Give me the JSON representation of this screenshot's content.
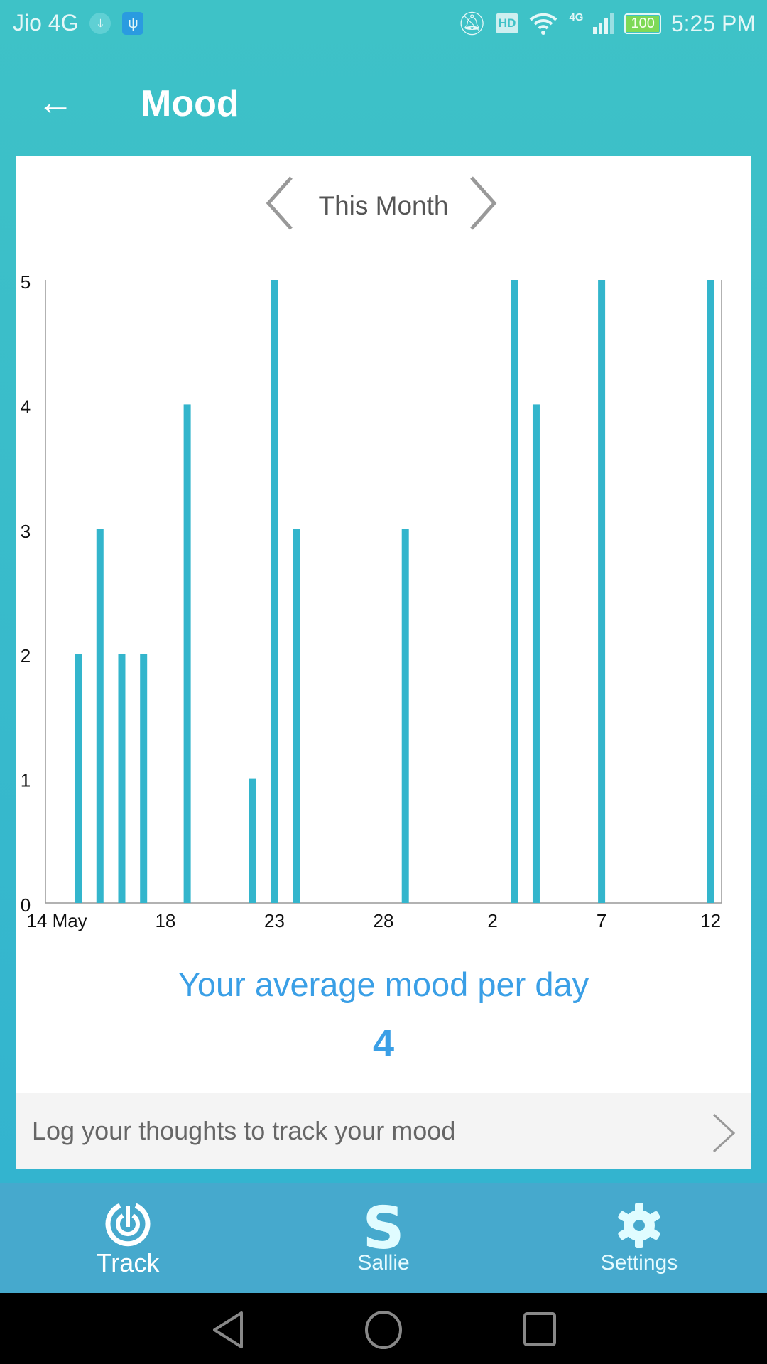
{
  "status": {
    "carrier": "Jio 4G",
    "network": "4G",
    "battery": "100",
    "time": "5:25 PM",
    "hd": "HD"
  },
  "header": {
    "title": "Mood",
    "back_icon": "arrow-left-icon"
  },
  "period": {
    "label": "This Month"
  },
  "chart_data": {
    "type": "bar",
    "ylim": [
      0,
      5
    ],
    "yticks": [
      "0",
      "1",
      "2",
      "3",
      "4",
      "5"
    ],
    "xticks": [
      {
        "day": 0,
        "label": "14 May"
      },
      {
        "day": 4,
        "label": "18"
      },
      {
        "day": 9,
        "label": "23"
      },
      {
        "day": 14,
        "label": "28"
      },
      {
        "day": 19,
        "label": "2"
      },
      {
        "day": 24,
        "label": "7"
      },
      {
        "day": 29,
        "label": "12"
      }
    ],
    "categories": [
      "14 May",
      "15 May",
      "16 May",
      "17 May",
      "19 May",
      "22 May",
      "23 May",
      "24 May",
      "29 May",
      "3 Jun",
      "4 Jun",
      "7 Jun",
      "12 Jun"
    ],
    "days": [
      0,
      1,
      2,
      3,
      5,
      8,
      9,
      10,
      15,
      20,
      21,
      24,
      29
    ],
    "values": [
      2,
      3,
      2,
      2,
      4,
      1,
      5,
      3,
      3,
      5,
      4,
      5,
      5
    ],
    "bar_color": "#33b5cc"
  },
  "summary": {
    "label": "Your average mood per day",
    "value": "4"
  },
  "log": {
    "label": "Log your thoughts to track your mood"
  },
  "nav": {
    "items": [
      {
        "label": "Track",
        "icon": "track-icon"
      },
      {
        "label": "Sallie",
        "icon": "sallie-icon"
      },
      {
        "label": "Settings",
        "icon": "gear-icon"
      }
    ]
  },
  "colors": {
    "accent": "#3ec2c7",
    "nav": "#46a9cd",
    "avg_text": "#3a9fe6"
  }
}
